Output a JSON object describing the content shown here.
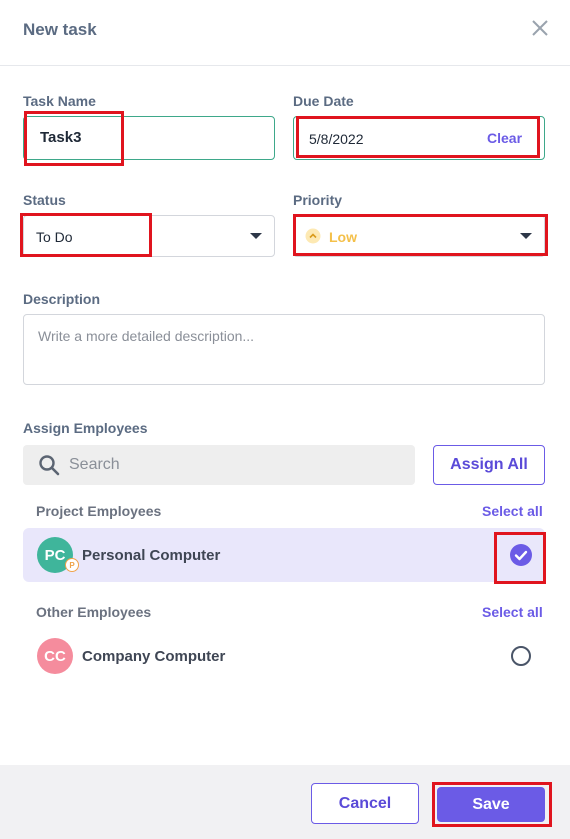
{
  "dialog": {
    "title": "New task"
  },
  "task_name": {
    "label": "Task Name",
    "value": "Task3"
  },
  "due_date": {
    "label": "Due Date",
    "value": "5/8/2022",
    "clear_label": "Clear"
  },
  "status": {
    "label": "Status",
    "value": "To Do"
  },
  "priority": {
    "label": "Priority",
    "value": "Low",
    "color": "#f4c04a"
  },
  "description": {
    "label": "Description",
    "placeholder": "Write a more detailed description..."
  },
  "assign": {
    "label": "Assign Employees",
    "search_placeholder": "Search",
    "assign_all_label": "Assign All"
  },
  "project_employees": {
    "title": "Project Employees",
    "select_all_label": "Select all",
    "items": [
      {
        "initials": "PC",
        "name": "Personal Computer",
        "badge": "P",
        "avatar_color": "#3fb59b",
        "selected": true
      }
    ]
  },
  "other_employees": {
    "title": "Other Employees",
    "select_all_label": "Select all",
    "items": [
      {
        "initials": "CC",
        "name": "Company Computer",
        "avatar_color": "#f58c9d",
        "selected": false
      }
    ]
  },
  "footer": {
    "cancel_label": "Cancel",
    "save_label": "Save"
  },
  "colors": {
    "accent": "#6b5be6",
    "annotation": "#e0141e",
    "focus_border": "#3ea88a"
  }
}
